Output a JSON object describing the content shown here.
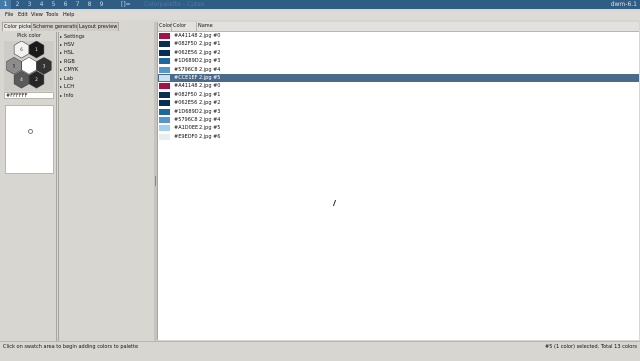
{
  "wm": {
    "tags": [
      "1",
      "2",
      "3",
      "4",
      "5",
      "6",
      "7",
      "8",
      "9"
    ],
    "active_tag": 0,
    "layout": "[]=",
    "title": "Colorpalette - Cptex",
    "status": "dwm-6.1"
  },
  "menubar": [
    "File",
    "Edit",
    "View",
    "Tools",
    "Help"
  ],
  "tabs": [
    "Color picker",
    "Scheme generation",
    "Layout preview"
  ],
  "picker": {
    "label": "Pick color",
    "hex_value": "#FFFFFF",
    "hex_cells": [
      {
        "color": "#f2f2f2",
        "text": "6",
        "text_color": "#333333"
      },
      {
        "color": "#1a1a1a",
        "text": "1",
        "text_color": "#ffffff"
      },
      {
        "color": "#8c8c8c",
        "text": "5",
        "text_color": "#111111"
      },
      {
        "color": "#ffffff",
        "text": "",
        "text_color": "#111111"
      },
      {
        "color": "#262626",
        "text": "2",
        "text_color": "#ffffff"
      },
      {
        "color": "#5a5a5a",
        "text": "4",
        "text_color": "#ffffff"
      },
      {
        "color": "#333333",
        "text": "3",
        "text_color": "#ffffff"
      }
    ]
  },
  "tree": [
    "Settings",
    "HSV",
    "HSL",
    "RGB",
    "CMYK",
    "Lab",
    "LCH",
    "Info"
  ],
  "table": {
    "headers": [
      "Color",
      "Color",
      "Name"
    ],
    "selected_index": 5,
    "rows": [
      {
        "swatch": "#A41148",
        "hex": "#A41148",
        "name": "2.jpg #0"
      },
      {
        "swatch": "#082F50",
        "hex": "#082F50",
        "name": "2.jpg #1"
      },
      {
        "swatch": "#062E56",
        "hex": "#062E56",
        "name": "2.jpg #2"
      },
      {
        "swatch": "#1D689D",
        "hex": "#1D689D",
        "name": "2.jpg #3"
      },
      {
        "swatch": "#5796C8",
        "hex": "#5796C8",
        "name": "2.jpg #4"
      },
      {
        "swatch": "#CCE1EF",
        "hex": "#CCE1EF",
        "name": "2.jpg #5"
      },
      {
        "swatch": "#A41148",
        "hex": "#A41148",
        "name": "2.jpg #0"
      },
      {
        "swatch": "#082F50",
        "hex": "#082F50",
        "name": "2.jpg #1"
      },
      {
        "swatch": "#062E56",
        "hex": "#062E56",
        "name": "2.jpg #2"
      },
      {
        "swatch": "#1D689D",
        "hex": "#1D689D",
        "name": "2.jpg #3"
      },
      {
        "swatch": "#5796C8",
        "hex": "#5796C8",
        "name": "2.jpg #4"
      },
      {
        "swatch": "#A1D0EE",
        "hex": "#A1D0EE",
        "name": "2.jpg #5"
      },
      {
        "swatch": "#E9EDF0",
        "hex": "#E9EDF0",
        "name": "2.jpg #6"
      }
    ]
  },
  "status": {
    "left": "Click on swatch area to begin adding colors to palette",
    "right": "#5 (1 color) selected. Total 13 colors"
  },
  "colors": {
    "wm_bar": "#2f5d84",
    "selection": "#4a6a8c",
    "panel": "#d8d6d1"
  }
}
